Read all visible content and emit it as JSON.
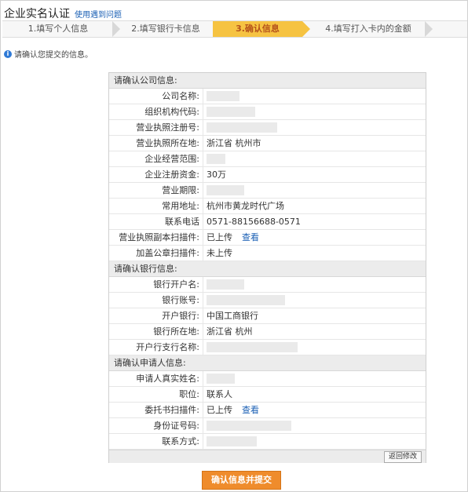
{
  "header": {
    "title": "企业实名认证",
    "help_link": "使用遇到问题"
  },
  "steps": [
    {
      "label": "1.填写个人信息",
      "active": false
    },
    {
      "label": "2.填写银行卡信息",
      "active": false
    },
    {
      "label": "3.确认信息",
      "active": true
    },
    {
      "label": "4.填写打入卡内的金额",
      "active": false
    }
  ],
  "notice": "请确认您提交的信息。",
  "company": {
    "heading": "请确认公司信息:",
    "rows": [
      {
        "label": "公司名称:",
        "value": ""
      },
      {
        "label": "组织机构代码:",
        "value": ""
      },
      {
        "label": "营业执照注册号:",
        "value": ""
      },
      {
        "label": "营业执照所在地:",
        "value": "浙江省 杭州市"
      },
      {
        "label": "企业经营范围:",
        "value": ""
      },
      {
        "label": "企业注册资金:",
        "value": "30万"
      },
      {
        "label": "营业期限:",
        "value": ""
      },
      {
        "label": "常用地址:",
        "value": "杭州市黄龙时代广场"
      },
      {
        "label": "联系电话",
        "value": "0571-88156688-0571"
      },
      {
        "label": "营业执照副本扫描件:",
        "value": "已上传",
        "link": "查看"
      },
      {
        "label": "加盖公章扫描件:",
        "value": "未上传"
      }
    ]
  },
  "bank": {
    "heading": "请确认银行信息:",
    "rows": [
      {
        "label": "银行开户名:",
        "value": ""
      },
      {
        "label": "银行账号:",
        "value": ""
      },
      {
        "label": "开户银行:",
        "value": "中国工商银行"
      },
      {
        "label": "银行所在地:",
        "value": "浙江省 杭州"
      },
      {
        "label": "开户行支行名称:",
        "value": ""
      }
    ]
  },
  "applicant": {
    "heading": "请确认申请人信息:",
    "rows": [
      {
        "label": "申请人真实姓名:",
        "value": ""
      },
      {
        "label": "职位:",
        "value": "联系人"
      },
      {
        "label": "委托书扫描件:",
        "value": "已上传",
        "link": "查看"
      },
      {
        "label": "身份证号码:",
        "value": ""
      },
      {
        "label": "联系方式:",
        "value": ""
      }
    ]
  },
  "actions": {
    "back_label": "返回修改",
    "submit_label": "确认信息并提交"
  },
  "colors": {
    "active_step": "#f6c342",
    "submit": "#ef8c2c",
    "link": "#1a5fb4"
  }
}
